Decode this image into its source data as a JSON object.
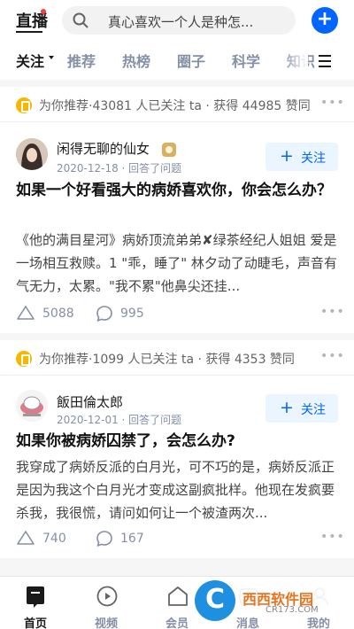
{
  "header": {
    "live_label": "直播",
    "search_placeholder": "真心喜欢一个人是种怎...",
    "add_label": "+"
  },
  "tabs": [
    {
      "label": "关注",
      "active": true
    },
    {
      "label": "推荐",
      "active": false
    },
    {
      "label": "热榜",
      "active": false
    },
    {
      "label": "圈子",
      "active": false
    },
    {
      "label": "科学",
      "active": false
    },
    {
      "label": "知识",
      "active": false
    }
  ],
  "feed": [
    {
      "recommend_text": "为你推荐·43081 人已关注 ta · 获得 44985 赞同",
      "author": "闲得无聊的仙女",
      "meta": "2020-12-18 · 回答了问题",
      "follow_label": "关注",
      "title": "如果一个好看强大的病娇喜欢你，你会怎么办？",
      "excerpt": "《他的满目星河》病娇顶流弟弟✘绿茶经纪人姐姐 爱是一场相互救赎。1 \"乖，睡了\" 林夕动了动睫毛，声音有气无力，太累。\"我不累\"他鼻尖还挂...",
      "upvotes": "5088",
      "comments": "995"
    },
    {
      "recommend_text": "为你推荐·1099 人已关注 ta · 获得 4353 赞同",
      "author": "飯田倫太郎",
      "meta": "2020-12-01 · 回答了问题",
      "follow_label": "关注",
      "title": "如果你被病娇囚禁了，会怎么办?",
      "excerpt": "我穿成了病娇反派的白月光，可不巧的是，病娇反派正是因为我这个白月光才变成这副疯批样。他现在发疯要杀我，我很慌，请问如何让一个被渣两次...",
      "upvotes": "740",
      "comments": "167"
    }
  ],
  "tabbar": [
    {
      "label": "首页",
      "icon": "home-icon",
      "active": true
    },
    {
      "label": "视频",
      "icon": "video-play-icon",
      "active": false
    },
    {
      "label": "会员",
      "icon": "member-icon",
      "active": false
    },
    {
      "label": "消息",
      "icon": "message-icon",
      "active": false
    },
    {
      "label": "我的",
      "icon": "profile-icon",
      "active": false
    }
  ],
  "watermark": {
    "logo_letter": "C",
    "main": "西西软件园",
    "sub": "CR173.COM"
  },
  "colors": {
    "accent": "#0066ff",
    "secondary_text": "#8590a6",
    "recommend_icon": "#f5b700"
  }
}
